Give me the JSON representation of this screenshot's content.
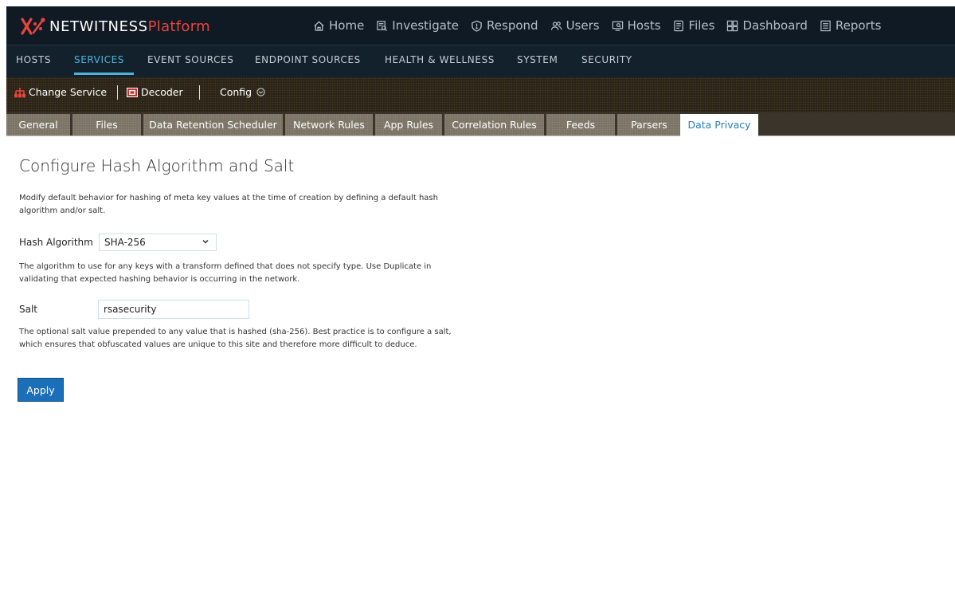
{
  "header": {
    "brand_name": "NETWITNESS",
    "brand_suffix": "Platform",
    "nav": [
      {
        "label": "Home",
        "icon": "home-icon"
      },
      {
        "label": "Investigate",
        "icon": "investigate-icon"
      },
      {
        "label": "Respond",
        "icon": "respond-icon"
      },
      {
        "label": "Users",
        "icon": "users-icon"
      },
      {
        "label": "Hosts",
        "icon": "hosts-icon"
      },
      {
        "label": "Files",
        "icon": "files-icon"
      },
      {
        "label": "Dashboard",
        "icon": "dashboard-icon"
      },
      {
        "label": "Reports",
        "icon": "reports-icon"
      }
    ]
  },
  "admin_nav": {
    "items": [
      "HOSTS",
      "SERVICES",
      "EVENT SOURCES",
      "ENDPOINT SOURCES",
      "HEALTH & WELLNESS",
      "SYSTEM",
      "SECURITY"
    ],
    "active": "SERVICES"
  },
  "toolbar": {
    "change_service": "Change Service",
    "service_name": "Decoder",
    "config": "Config"
  },
  "tabs": {
    "items": [
      "General",
      "Files",
      "Data Retention Scheduler",
      "Network Rules",
      "App Rules",
      "Correlation Rules",
      "Feeds",
      "Parsers",
      "Data Privacy"
    ],
    "active": "Data Privacy"
  },
  "content": {
    "title": "Configure Hash Algorithm and Salt",
    "intro": "Modify default behavior for hashing of meta key values at the time of creation by defining a default hash algorithm and/or salt.",
    "hash_label": "Hash Algorithm",
    "hash_value": "SHA-256",
    "hash_help": "The algorithm to use for any keys with a transform defined that does not specify type. Use Duplicate in validating that expected hashing behavior is occurring in the network.",
    "salt_label": "Salt",
    "salt_value": "rsasecurity",
    "salt_help": "The optional salt value prepended to any value that is hashed (sha-256). Best practice is to configure a salt, which ensures that obfuscated values are unique to this site and therefore more difficult to deduce.",
    "apply_label": "Apply"
  },
  "colors": {
    "topbar_bg": "#0f1a24",
    "accent": "#4fb3d9",
    "brand_red": "#e8453c",
    "active_tab_text": "#2a7fb8",
    "apply_bg": "#1a6fb8"
  }
}
